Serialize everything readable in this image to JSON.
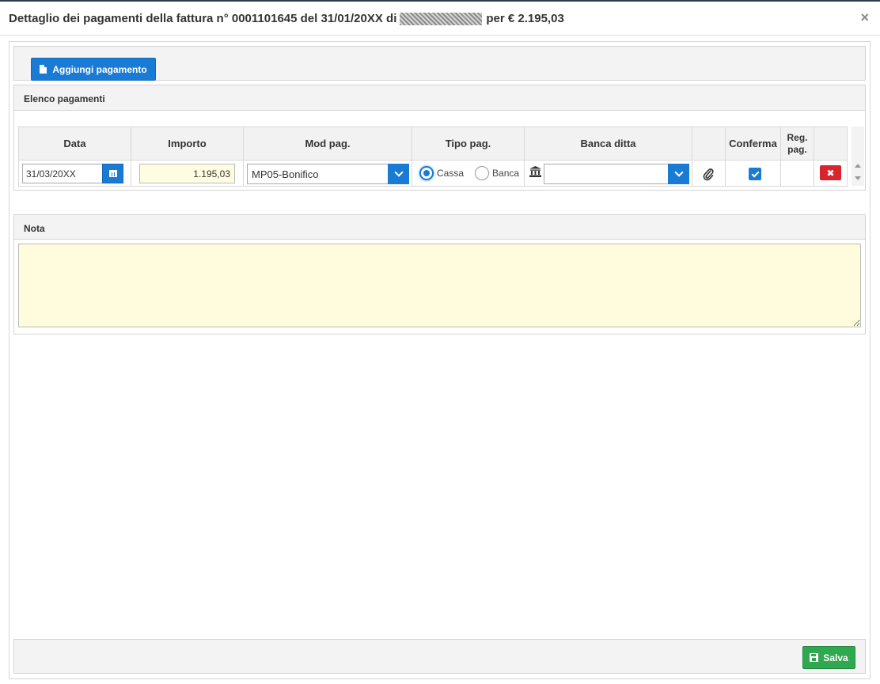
{
  "dialog": {
    "title_prefix": "Dettaglio dei pagamenti della fattura n° 0001101645 del 31/01/20XX di",
    "title_suffix": "per € 2.195,03",
    "close_symbol": "×"
  },
  "toolbar": {
    "add_payment_label": "Aggiungi pagamento",
    "add_icon": "document-icon"
  },
  "payments": {
    "section_title": "Elenco pagamenti",
    "columns": {
      "date": "Data",
      "amount": "Importo",
      "method": "Mod pag.",
      "type": "Tipo pag.",
      "bank": "Banca ditta",
      "attach": "",
      "confirm": "Conferma",
      "reg": "Reg. pag.",
      "actions": ""
    },
    "rows": [
      {
        "date": "31/03/20XX",
        "amount": "1.195,03",
        "method": "MP05-Bonifico",
        "type_options": [
          "Cassa",
          "Banca"
        ],
        "type_selected": "Cassa",
        "bank": "",
        "confirmed": true,
        "delete_symbol": "✖"
      }
    ]
  },
  "note": {
    "section_title": "Nota",
    "value": ""
  },
  "footer": {
    "save_label": "Salva",
    "save_icon": "floppy-disk-icon"
  },
  "colors": {
    "primary": "#1a7bd4",
    "success": "#2fa84f",
    "danger": "#d9232d",
    "input_highlight": "#fefcdc"
  }
}
